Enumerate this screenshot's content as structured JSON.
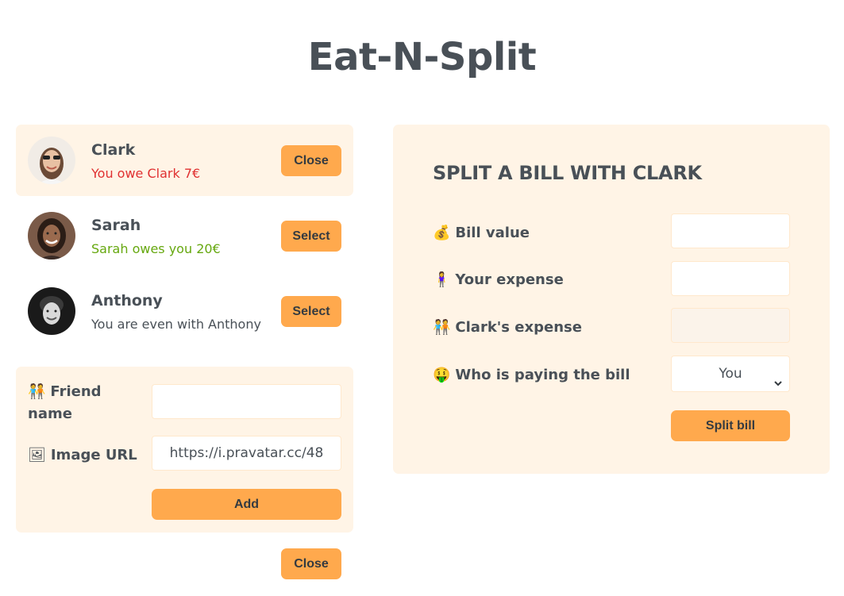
{
  "app": {
    "title": "Eat-N-Split"
  },
  "friends": [
    {
      "name": "Clark",
      "status": "You owe Clark 7€",
      "button": "Close",
      "selected": true
    },
    {
      "name": "Sarah",
      "status": "Sarah owes you 20€",
      "button": "Select",
      "selected": false
    },
    {
      "name": "Anthony",
      "status": "You are even with Anthony",
      "button": "Select",
      "selected": false
    }
  ],
  "add_form": {
    "friend_name_label": "Friend name",
    "friend_name_emoji": "🧑‍🤝‍🧑",
    "friend_name_value": "",
    "image_url_label": "Image URL",
    "image_url_emoji": "🖼",
    "image_url_value": "https://i.pravatar.cc/48",
    "add_button": "Add"
  },
  "close_button": "Close",
  "split": {
    "title": "SPLIT A BILL WITH CLARK",
    "bill_label": "Bill value",
    "bill_emoji": "💰",
    "bill_value": "",
    "your_label": "Your expense",
    "your_emoji": "🧍‍♀️",
    "your_value": "",
    "friend_label": "Clark's expense",
    "friend_emoji": "🧑‍🤝‍🧑",
    "friend_value": "",
    "payer_label": "Who is paying the bill",
    "payer_emoji": "🤑",
    "payer_value": "You",
    "split_button": "Split bill"
  },
  "colors": {
    "accent": "#ffa94d",
    "panel": "#fff4e6",
    "owe": "#e03131",
    "owed": "#66a80f",
    "text": "#495057"
  }
}
